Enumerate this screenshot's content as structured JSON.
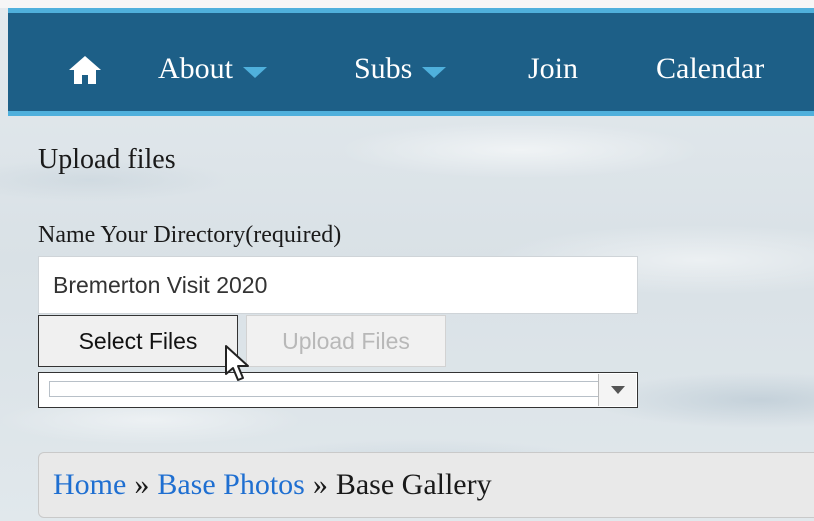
{
  "nav": {
    "items": [
      {
        "label": "About",
        "has_dropdown": true
      },
      {
        "label": "Subs",
        "has_dropdown": true
      },
      {
        "label": "Join",
        "has_dropdown": false
      },
      {
        "label": "Calendar",
        "has_dropdown": false
      }
    ],
    "home_icon": "home-icon",
    "colors": {
      "bar": "#1d5f87",
      "accent": "#4fb0dc",
      "text": "#ffffff"
    }
  },
  "upload": {
    "title": "Upload files",
    "directory_label": "Name Your Directory(required)",
    "directory_value": "Bremerton Visit 2020",
    "select_button": "Select Files",
    "upload_button": "Upload Files",
    "upload_enabled": false,
    "progress_value": 0
  },
  "breadcrumb": {
    "items": [
      {
        "label": "Home",
        "link": true
      },
      {
        "label": "Base Photos",
        "link": true
      },
      {
        "label": "Base Gallery",
        "link": false
      }
    ],
    "separator": "»",
    "link_color": "#1f6fd1"
  }
}
